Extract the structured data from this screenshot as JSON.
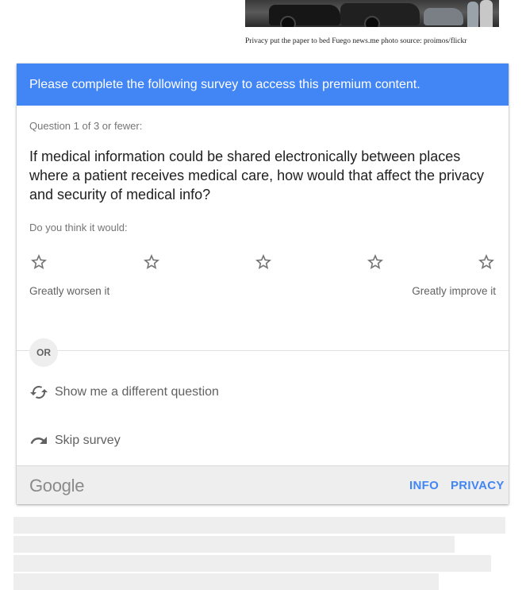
{
  "photo": {
    "caption": "Privacy put the paper to bed Fuego news.me photo source: proimos/flickr"
  },
  "survey": {
    "header": "Please complete the following survey to access this premium content.",
    "question_count": "Question 1 of 3 or fewer:",
    "question": "If medical information could be shared electronically between places where a patient receives medical care, how would that affect the privacy and security of medical info?",
    "prompt": "Do you think it would:",
    "rating": {
      "max": 5,
      "selected": 0,
      "star_icon": "star-outline-icon",
      "label_low": "Greatly worsen it",
      "label_high": "Greatly improve it"
    },
    "or_label": "OR",
    "different_question": "Show me a different question",
    "different_question_icon": "refresh-icon",
    "skip": "Skip survey",
    "skip_icon": "redo-arrow-icon",
    "footer": {
      "brand": "Google",
      "info": "INFO",
      "privacy": "PRIVACY"
    }
  },
  "colors": {
    "accent": "#4285f4",
    "header_text": "#ffffff",
    "footer_bg": "#eeeeee",
    "placeholder_bar": "#eeeeee"
  }
}
